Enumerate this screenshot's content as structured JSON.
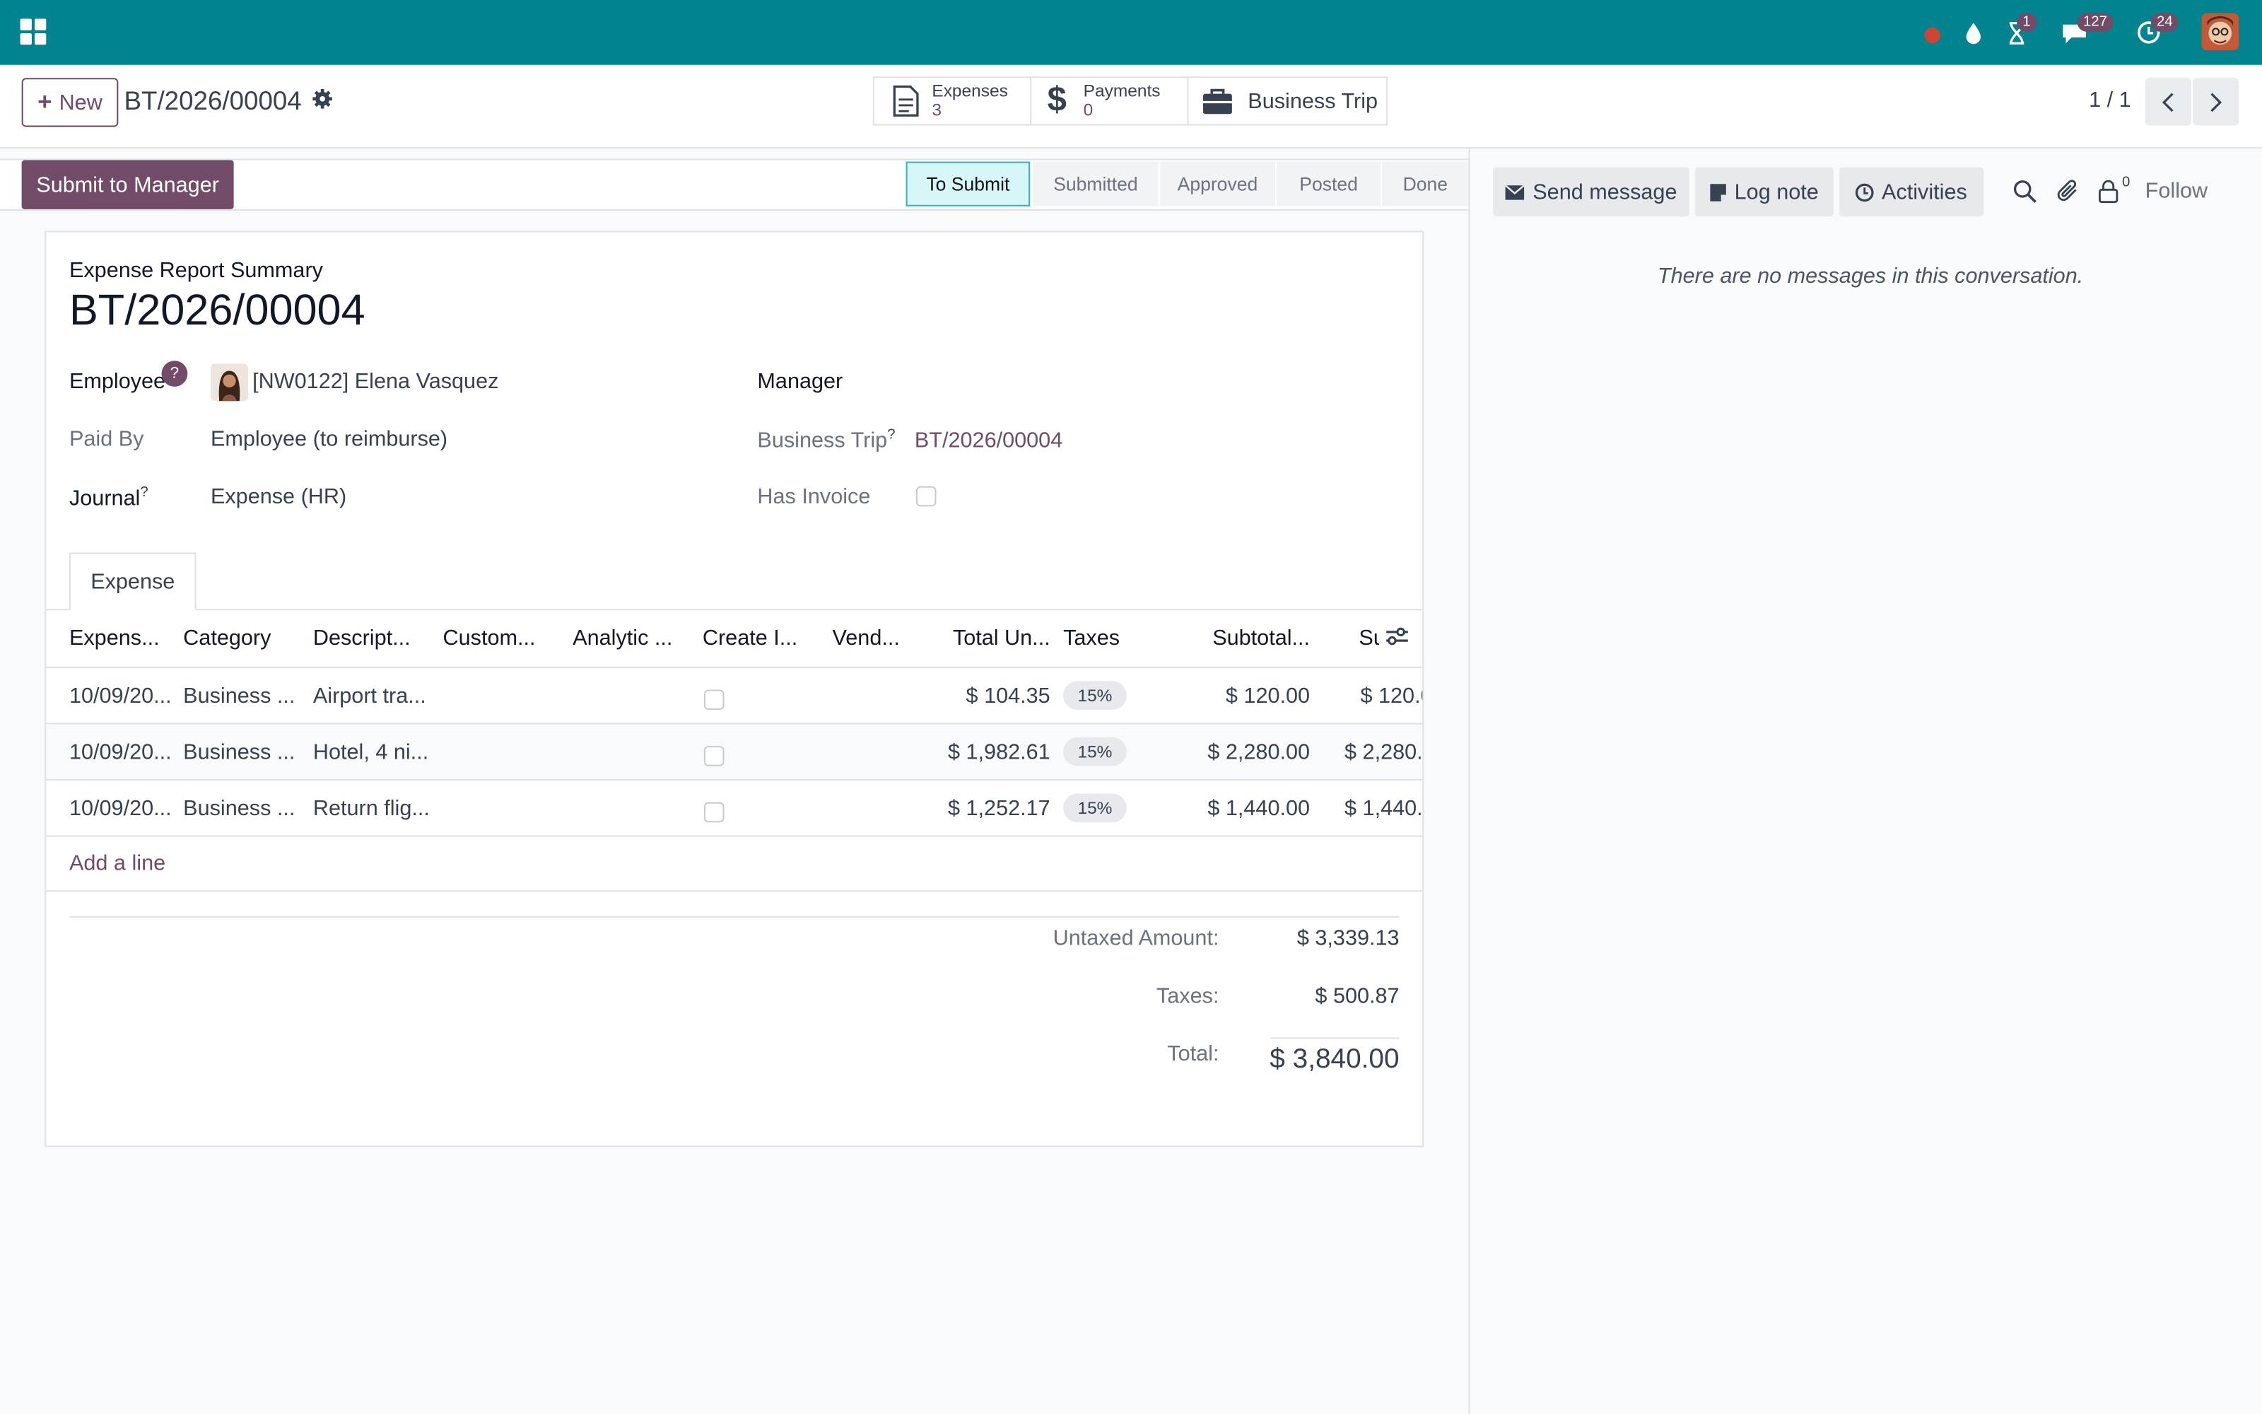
{
  "navbar": {
    "apps_icon": "apps-grid-icon",
    "activity_count": "1",
    "messages_count": "127",
    "updates_count": "24"
  },
  "control_panel": {
    "new_label": "New",
    "breadcrumb": "BT/2026/00004",
    "smart_buttons": [
      {
        "label": "Expenses",
        "value": "3",
        "icon": "document-icon"
      },
      {
        "label": "Payments",
        "value": "0",
        "icon": "dollar-icon"
      },
      {
        "label": "Business Trip",
        "icon": "briefcase-icon"
      }
    ],
    "pager": "1 / 1"
  },
  "statusbar": {
    "submit_label": "Submit to Manager",
    "stages": [
      "To Submit",
      "Submitted",
      "Approved",
      "Posted",
      "Done"
    ],
    "current_stage": "To Submit"
  },
  "form": {
    "summary_label": "Expense Report Summary",
    "title": "BT/2026/00004",
    "employee_label": "Employee",
    "employee_help": "?",
    "employee_value": "[NW0122] Elena Vasquez",
    "manager_label": "Manager",
    "paid_by_label": "Paid By",
    "paid_by_value": "Employee (to reimburse)",
    "business_trip_label": "Business Trip",
    "business_trip_value": "BT/2026/00004",
    "journal_label": "Journal",
    "journal_value": "Expense (HR)",
    "has_invoice_label": "Has Invoice",
    "qmark": "?"
  },
  "tabs": [
    {
      "label": "Expense"
    }
  ],
  "table": {
    "headers": [
      "Expens...",
      "Category",
      "Descript...",
      "Custom...",
      "Analytic ...",
      "Create I...",
      "Vend...",
      "Total Un...",
      "Taxes",
      "Subtotal...",
      "Su"
    ],
    "rows": [
      {
        "date": "10/09/20...",
        "category": "Business ...",
        "description": "Airport tra...",
        "total_unit": "$ 104.35",
        "tax": "15%",
        "subtotal": "$ 120.00",
        "sum": "$ 120.0"
      },
      {
        "date": "10/09/20...",
        "category": "Business ...",
        "description": "Hotel, 4 ni...",
        "total_unit": "$ 1,982.61",
        "tax": "15%",
        "subtotal": "$ 2,280.00",
        "sum": "$ 2,280.0"
      },
      {
        "date": "10/09/20...",
        "category": "Business ...",
        "description": "Return flig...",
        "total_unit": "$ 1,252.17",
        "tax": "15%",
        "subtotal": "$ 1,440.00",
        "sum": "$ 1,440.0"
      }
    ],
    "add_line": "Add a line"
  },
  "totals": {
    "untaxed_label": "Untaxed Amount:",
    "untaxed_value": "$ 3,339.13",
    "taxes_label": "Taxes:",
    "taxes_value": "$ 500.87",
    "total_label": "Total:",
    "total_value": "$ 3,840.00"
  },
  "chatter": {
    "send_message": "Send message",
    "log_note": "Log note",
    "activities": "Activities",
    "followers_count": "0",
    "follow": "Follow",
    "empty_text": "There are no messages in this conversation."
  },
  "colors": {
    "navbar": "#01848f",
    "brand": "#714b67",
    "current_stage": "#d6f6f8"
  }
}
